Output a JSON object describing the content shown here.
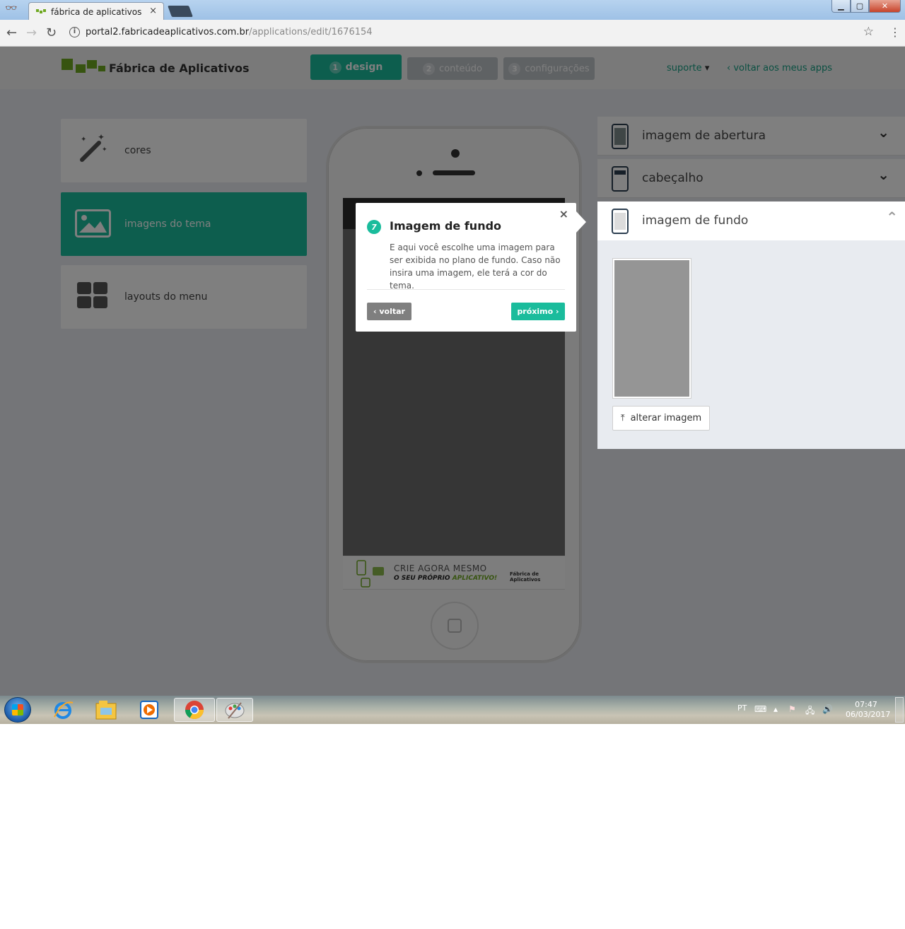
{
  "browser": {
    "tab_title": "fábrica de aplicativos",
    "tab_close": "×",
    "url_host": "portal2.fabricadeaplicativos.com.br",
    "url_path": "/applications/edit/1676154",
    "info_icon": "i",
    "star_icon": "☆",
    "menu_icon": "⋮",
    "back_icon": "←",
    "forward_icon": "→",
    "reload_icon": "↻",
    "min_icon": "▁",
    "max_icon": "▢",
    "close_icon": "✕",
    "incognito_icon": "👓"
  },
  "app": {
    "logo_text": "Fábrica de Aplicativos",
    "brand_color": "#1abc9c",
    "steps": [
      {
        "num": "1",
        "label": "design"
      },
      {
        "num": "2",
        "label": "conteúdo"
      },
      {
        "num": "3",
        "label": "configurações"
      }
    ],
    "suporte": "suporte",
    "suporte_caret": "▾",
    "voltar_apps": "voltar aos meus apps",
    "voltar_chevron": "‹"
  },
  "left_menu": {
    "items": [
      {
        "label": "cores",
        "icon": "magic-wand-icon"
      },
      {
        "label": "imagens do tema",
        "icon": "image-icon"
      },
      {
        "label": "layouts do menu",
        "icon": "grid-icon"
      }
    ]
  },
  "phone": {
    "ad_line1": "CRIE AGORA MESMO",
    "ad_line2_a": "O SEU PRÓPRIO ",
    "ad_line2_b": "APLICATIVO!",
    "ad_brand": "Fábrica de Aplicativos"
  },
  "right_panel": {
    "sections": [
      {
        "title": "imagem de abertura",
        "chevron": "⌄"
      },
      {
        "title": "cabeçalho",
        "chevron": "⌄"
      },
      {
        "title": "imagem de fundo",
        "chevron": "⌃"
      }
    ],
    "alterar_label": "alterar imagem",
    "upload_icon": "⤒"
  },
  "tooltip": {
    "step": "7",
    "title": "Imagem de fundo",
    "text": "E aqui você escolhe uma imagem para ser exibida no plano de fundo. Caso não insira uma imagem, ele terá a cor do tema.",
    "close": "×",
    "back_label": "‹ voltar",
    "next_label": "próximo ›"
  },
  "taskbar": {
    "lang": "PT",
    "time": "07:47",
    "date": "06/03/2017"
  }
}
